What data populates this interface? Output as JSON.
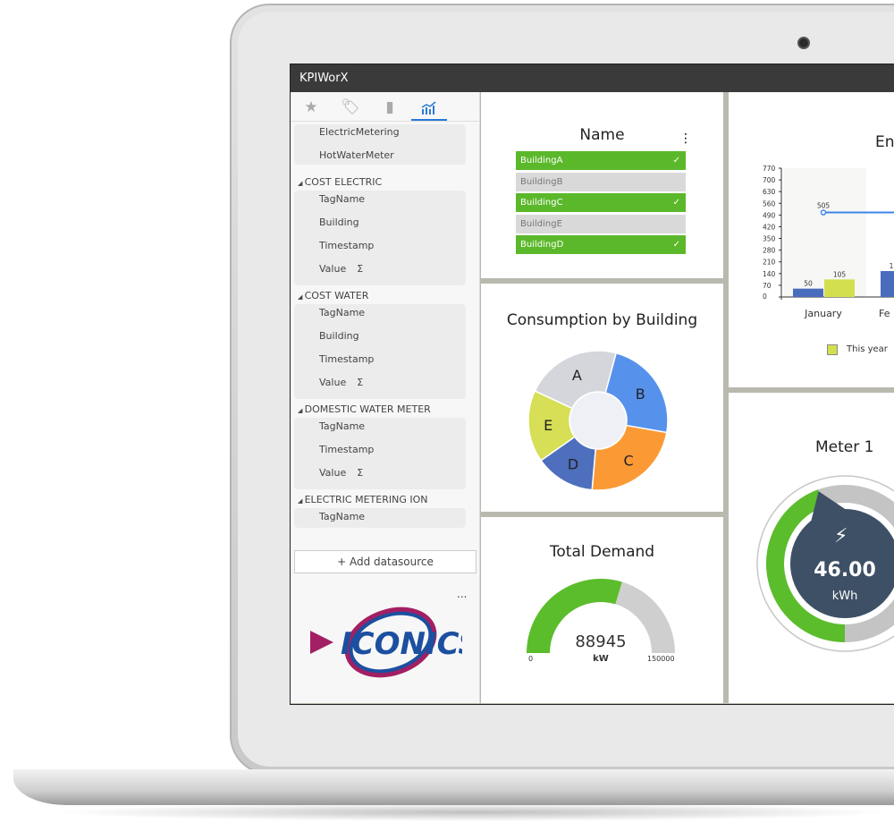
{
  "app": {
    "title": "KPIWorX"
  },
  "sidebar": {
    "tabs": [
      {
        "icon": "star-icon"
      },
      {
        "icon": "tag-icon"
      },
      {
        "icon": "book-icon"
      },
      {
        "icon": "chart-icon"
      }
    ],
    "top_items": [
      "ElectricMetering",
      "HotWaterMeter"
    ],
    "groups": [
      {
        "name": "COST ELECTRIC",
        "items": [
          "TagName",
          "Building",
          "Timestamp",
          "Value"
        ]
      },
      {
        "name": "COST WATER",
        "items": [
          "TagName",
          "Building",
          "Timestamp",
          "Value"
        ]
      },
      {
        "name": "DOMESTIC WATER METER",
        "items": [
          "TagName",
          "Timestamp",
          "Value"
        ]
      },
      {
        "name": "ELECTRIC METERING ION",
        "items": [
          "TagName"
        ]
      }
    ],
    "sigma": "Σ",
    "add_datasource": "Add datasource",
    "more": "...",
    "logo": "ICONICS"
  },
  "name_panel": {
    "title": "Name",
    "menu": "⋮",
    "rows": [
      {
        "label": "BuildingA",
        "selected": true
      },
      {
        "label": "BuildingB",
        "selected": false
      },
      {
        "label": "BuildingC",
        "selected": true
      },
      {
        "label": "BuildingE",
        "selected": false
      },
      {
        "label": "BuildingD",
        "selected": true
      }
    ],
    "check": "✓"
  },
  "consumption": {
    "title": "Consumption by Building",
    "slices": [
      {
        "label": "A",
        "color": "#d4d6dc"
      },
      {
        "label": "B",
        "color": "#5692ec"
      },
      {
        "label": "C",
        "color": "#fb9a35"
      },
      {
        "label": "D",
        "color": "#4d6fbd"
      },
      {
        "label": "E",
        "color": "#d6df55"
      }
    ]
  },
  "demand": {
    "title": "Total Demand",
    "value": "88945",
    "unit": "kW",
    "min": "0",
    "max": "150000",
    "fraction": 0.593,
    "fill_color": "#5bbd2b",
    "track_color": "#cfcfcf"
  },
  "energy": {
    "title": "En",
    "yticks": [
      "770",
      "700",
      "630",
      "560",
      "490",
      "420",
      "350",
      "280",
      "210",
      "140",
      "70",
      "0"
    ],
    "categories": [
      "January",
      "Fe"
    ],
    "bars_last": [
      50,
      155
    ],
    "bars_this": [
      105
    ],
    "line": [
      505
    ],
    "labels": {
      "bar_jan_last": "50",
      "bar_jan_this": "105",
      "line_jan": "505",
      "bar_feb": "1"
    },
    "legend": "This year",
    "colors": {
      "last": "#4a6cbd",
      "this": "#d4df4f",
      "line": "#3f86e8"
    }
  },
  "meter": {
    "title": "Meter 1",
    "value": "46.00",
    "unit": "kWh",
    "icon": "lightning-icon",
    "fraction": 0.46,
    "fill_color": "#5bbd2b",
    "face_color": "#3e5066"
  }
}
